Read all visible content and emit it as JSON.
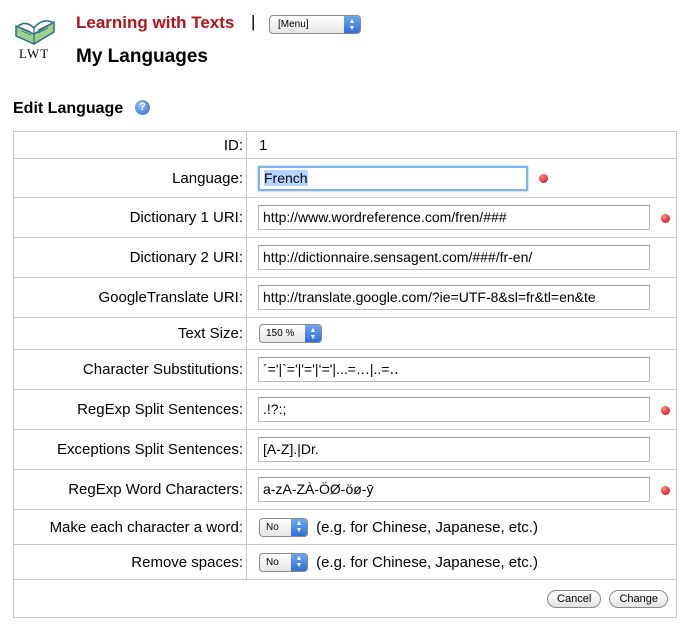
{
  "header": {
    "logo_text": "LWT",
    "app_title": "Learning with Texts",
    "separator": "|",
    "menu_value": "[Menu]",
    "page_title": "My Languages"
  },
  "section": {
    "title": "Edit Language",
    "help_icon": "help-icon"
  },
  "form": {
    "id_label": "ID:",
    "id_value": "1",
    "language_label": "Language:",
    "language_value": "French",
    "dict1_label": "Dictionary 1 URI:",
    "dict1_value": "http://www.wordreference.com/fren/###",
    "dict2_label": "Dictionary 2 URI:",
    "dict2_value": "http://dictionnaire.sensagent.com/###/fr-en/",
    "gtrans_label": "GoogleTranslate URI:",
    "gtrans_value": "http://translate.google.com/?ie=UTF-8&sl=fr&tl=en&te",
    "textsize_label": "Text Size:",
    "textsize_value": "150 %",
    "charsub_label": "Character Substitutions:",
    "charsub_value": "´='|`='|'='|‘='|...=…|..=‥",
    "regexp_split_label": "RegExp Split Sentences:",
    "regexp_split_value": ".!?:;",
    "exceptions_label": "Exceptions Split Sentences:",
    "exceptions_value": "[A-Z].|Dr.",
    "regexp_word_label": "RegExp Word Characters:",
    "regexp_word_value": "a-zA-ZÀ-ÖØ-öø-ȳ",
    "char_word_label": "Make each character a word:",
    "char_word_value": "No",
    "char_word_hint": "(e.g. for Chinese, Japanese, etc.)",
    "remove_spaces_label": "Remove spaces:",
    "remove_spaces_value": "No",
    "remove_spaces_hint": "(e.g. for Chinese, Japanese, etc.)"
  },
  "buttons": {
    "cancel": "Cancel",
    "change": "Change"
  },
  "colors": {
    "title_red": "#b5121b",
    "required_dot": "#c80000",
    "focus_blue": "#7fb0ef"
  }
}
